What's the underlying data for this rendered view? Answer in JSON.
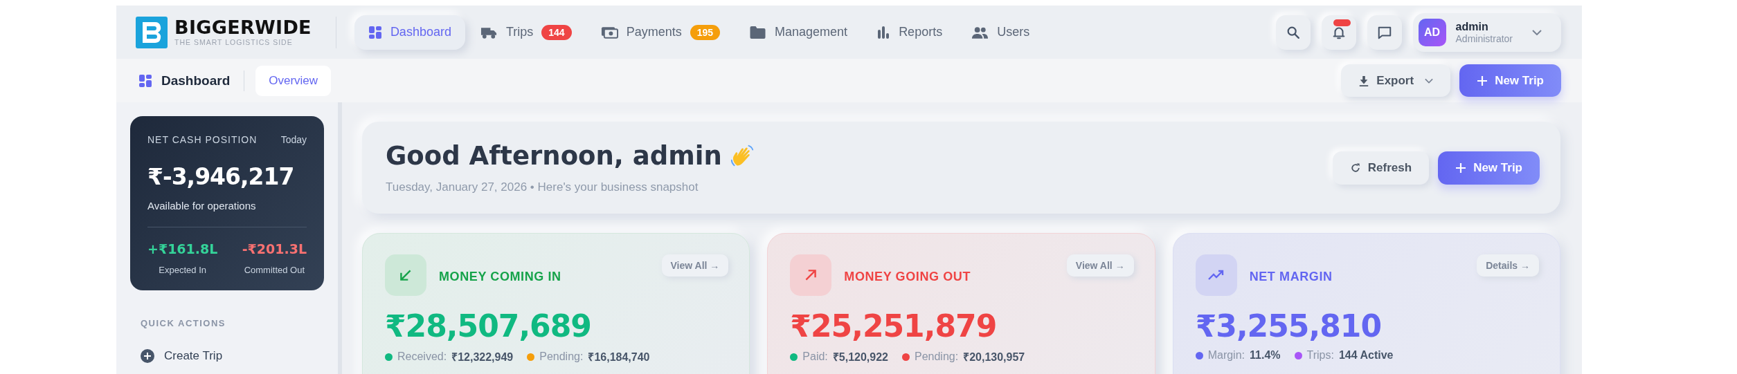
{
  "brand": {
    "name": "BIGGERWIDE",
    "tagline": "THE SMART LOGISTICS SIDE"
  },
  "nav": [
    {
      "label": "Dashboard",
      "selected": true
    },
    {
      "label": "Trips",
      "selected": false,
      "badge": "144",
      "color": "#ef4444"
    },
    {
      "label": "Payments",
      "selected": false,
      "badge": "195",
      "color": "#f59e0b"
    },
    {
      "label": "Management",
      "selected": false
    },
    {
      "label": "Reports",
      "selected": false
    },
    {
      "label": "Users",
      "selected": false
    }
  ],
  "notifications": {
    "unread": true
  },
  "user": {
    "initials": "AD",
    "name": "admin",
    "role": "Administrator"
  },
  "subbar": {
    "title": "Dashboard",
    "tabs": [
      {
        "label": "Overview",
        "selected": true
      }
    ],
    "export": "Export",
    "new_trip": "New Trip"
  },
  "cash": {
    "title": "NET CASH POSITION",
    "period": "Today",
    "amount": "₹-3,946,217",
    "caption": "Available for operations",
    "flows": [
      {
        "kind": "in",
        "value": "+₹161.8L",
        "label": "Expected In"
      },
      {
        "kind": "out",
        "value": "-₹201.3L",
        "label": "Committed Out"
      }
    ]
  },
  "quick_actions": {
    "heading": "QUICK ACTIONS",
    "items": [
      {
        "label": "Create Trip"
      }
    ]
  },
  "greeting": {
    "title": "Good Afternoon, admin",
    "subtitle": "Tuesday, January 27, 2026 • Here's your business snapshot",
    "refresh": "Refresh",
    "new_trip": "New Trip"
  },
  "stats": [
    {
      "kind": "in",
      "title": "MONEY COMING IN",
      "link": "View All →",
      "amount": "₹28,507,689",
      "details": [
        {
          "label": "Received:",
          "value": "₹12,322,949",
          "color": "#10b981"
        },
        {
          "label": "Pending:",
          "value": "₹16,184,740",
          "color": "#f59e0b"
        }
      ]
    },
    {
      "kind": "out",
      "title": "MONEY GOING OUT",
      "link": "View All →",
      "amount": "₹25,251,879",
      "details": [
        {
          "label": "Paid:",
          "value": "₹5,120,922",
          "color": "#10b981"
        },
        {
          "label": "Pending:",
          "value": "₹20,130,957",
          "color": "#ef4444"
        }
      ]
    },
    {
      "kind": "margin",
      "title": "NET MARGIN",
      "link": "Details →",
      "amount": "₹3,255,810",
      "details": [
        {
          "label": "Margin:",
          "value": "11.4%",
          "color": "#6366f1"
        },
        {
          "label": "Trips:",
          "value": "144 Active",
          "color": "#a855f7"
        }
      ]
    }
  ]
}
